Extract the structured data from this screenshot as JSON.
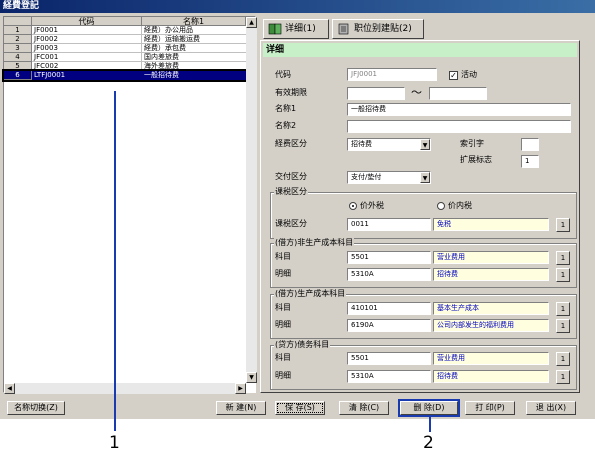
{
  "window": {
    "title": "経費登記"
  },
  "grid": {
    "headers": {
      "code": "代码",
      "name": "名称1"
    },
    "rows": [
      {
        "num": "1",
        "code": "JF0001",
        "name": "経费）办公用品"
      },
      {
        "num": "2",
        "code": "JF0002",
        "name": "経费）运输搬运费"
      },
      {
        "num": "3",
        "code": "JF0003",
        "name": "経费）承包费"
      },
      {
        "num": "4",
        "code": "JFC001",
        "name": "国内差旅费"
      },
      {
        "num": "5",
        "code": "JFC002",
        "name": "海外差旅费"
      },
      {
        "num": "6",
        "code": "LTFJ0001",
        "name": "一般招待费"
      }
    ]
  },
  "tabs": [
    {
      "label": "详细(1)",
      "icon": "book-icon"
    },
    {
      "label": "职位别建贴(2)",
      "icon": "document-icon"
    }
  ],
  "detail": {
    "header": "详细",
    "code_label": "代码",
    "code_value": "JFJ0001",
    "active_label": "活动",
    "active_checked": "✓",
    "period_label": "有效期限",
    "period_sep": "～",
    "name1_label": "名称1",
    "name1_value": "一般招待费",
    "name2_label": "名称2",
    "category_label": "経费区分",
    "category_value": "招待费",
    "index_label": "索引字",
    "ext_label": "扩展标志",
    "ext_value": "1",
    "payment_label": "交付区分",
    "payment_value": "支付/垫付",
    "tax_group": "课税区分",
    "tax_external": "价外税",
    "tax_internal": "价内税",
    "tax_label": "课税区分",
    "tax_code": "0011",
    "tax_name": "免税",
    "nonprod_group": "(借方)非生产成本科目",
    "nonprod_subject_label": "科目",
    "nonprod_subject_code": "5501",
    "nonprod_subject_name": "营业费用",
    "nonprod_detail_label": "明细",
    "nonprod_detail_code": "5310A",
    "nonprod_detail_name": "招待费",
    "prod_group": "(借方)生产成本科目",
    "prod_subject_label": "科目",
    "prod_subject_code": "410101",
    "prod_subject_name": "基本生产成本",
    "prod_detail_label": "明细",
    "prod_detail_code": "6190A",
    "prod_detail_name": "公司内部发生的福利费用",
    "credit_group": "(贷方)债务科目",
    "credit_subject_label": "科目",
    "credit_subject_code": "5501",
    "credit_subject_name": "营业费用",
    "credit_detail_label": "明细",
    "credit_detail_code": "5310A",
    "credit_detail_name": "招待费"
  },
  "buttons": {
    "switch_name": "名称切换(Z)",
    "new": "新 建(N)",
    "save": "保 存(S)",
    "clear": "清 除(C)",
    "delete": "删 除(D)",
    "print": "打 印(P)",
    "exit": "退 出(X)"
  },
  "callouts": {
    "one": "1",
    "two": "2"
  }
}
